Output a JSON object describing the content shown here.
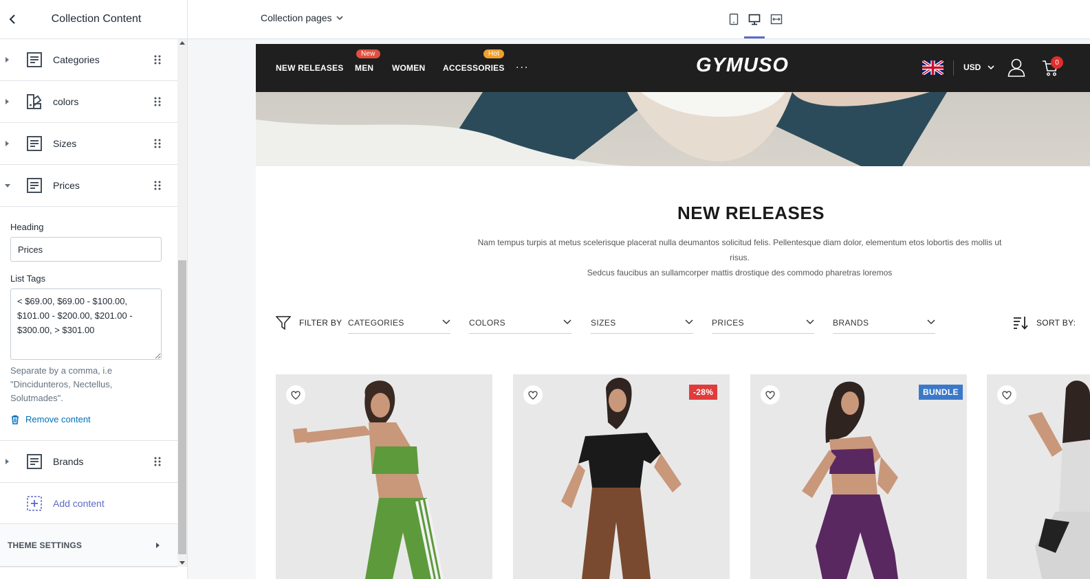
{
  "sidebar": {
    "title": "Collection Content",
    "items_top": [
      {
        "label": "Categories",
        "icon": "text-block-icon"
      },
      {
        "label": "colors",
        "icon": "color-swatch-icon"
      },
      {
        "label": "Sizes",
        "icon": "text-block-icon"
      },
      {
        "label": "Prices",
        "icon": "text-block-icon"
      }
    ],
    "expanded": {
      "heading_label": "Heading",
      "heading_value": "Prices",
      "list_tags_label": "List Tags",
      "list_tags_value": "< $69.00, $69.00 - $100.00, $101.00 - $200.00, $201.00 - $300.00, > $301.00",
      "help_text": "Separate by a comma, i.e \"Dincidunteros, Nectellus, Solutmades\".",
      "remove_label": "Remove content"
    },
    "items_bottom": [
      {
        "label": "Brands",
        "icon": "text-block-icon"
      }
    ],
    "add_content_label": "Add content",
    "theme_settings_label": "THEME SETTINGS"
  },
  "topbar": {
    "page_select": "Collection pages",
    "devices": [
      "mobile-icon",
      "desktop-icon",
      "fullscreen-icon"
    ],
    "active_device": "desktop-icon"
  },
  "store": {
    "nav": [
      {
        "label": "NEW RELEASES",
        "badge": ""
      },
      {
        "label": "MEN",
        "badge": "New"
      },
      {
        "label": "WOMEN",
        "badge": ""
      },
      {
        "label": "ACCESSORIES",
        "badge": "Hot"
      }
    ],
    "more": "...",
    "logo": "GYMUSO",
    "currency": "USD",
    "cart_count": "0",
    "badge_colors": {
      "new": "#e0503c",
      "hot": "#f0a030",
      "sale": "#e03c3c",
      "bundle": "#3c78c8"
    },
    "collection_title": "NEW RELEASES",
    "collection_desc_line1": "Nam tempus turpis at metus scelerisque placerat nulla deumantos solicitud felis. Pellentesque diam dolor, elementum etos lobortis des mollis ut risus.",
    "collection_desc_line2": "Sedcus faucibus an sullamcorper mattis drostique des commodo pharetras loremos",
    "filter_by": "FILTER BY",
    "filters": [
      "CATEGORIES",
      "COLORS",
      "SIZES",
      "PRICES",
      "BRANDS"
    ],
    "sort_by": "SORT BY:",
    "products": [
      {
        "badge": ""
      },
      {
        "badge": "-28%"
      },
      {
        "badge": "BUNDLE"
      },
      {
        "badge": ""
      }
    ]
  }
}
